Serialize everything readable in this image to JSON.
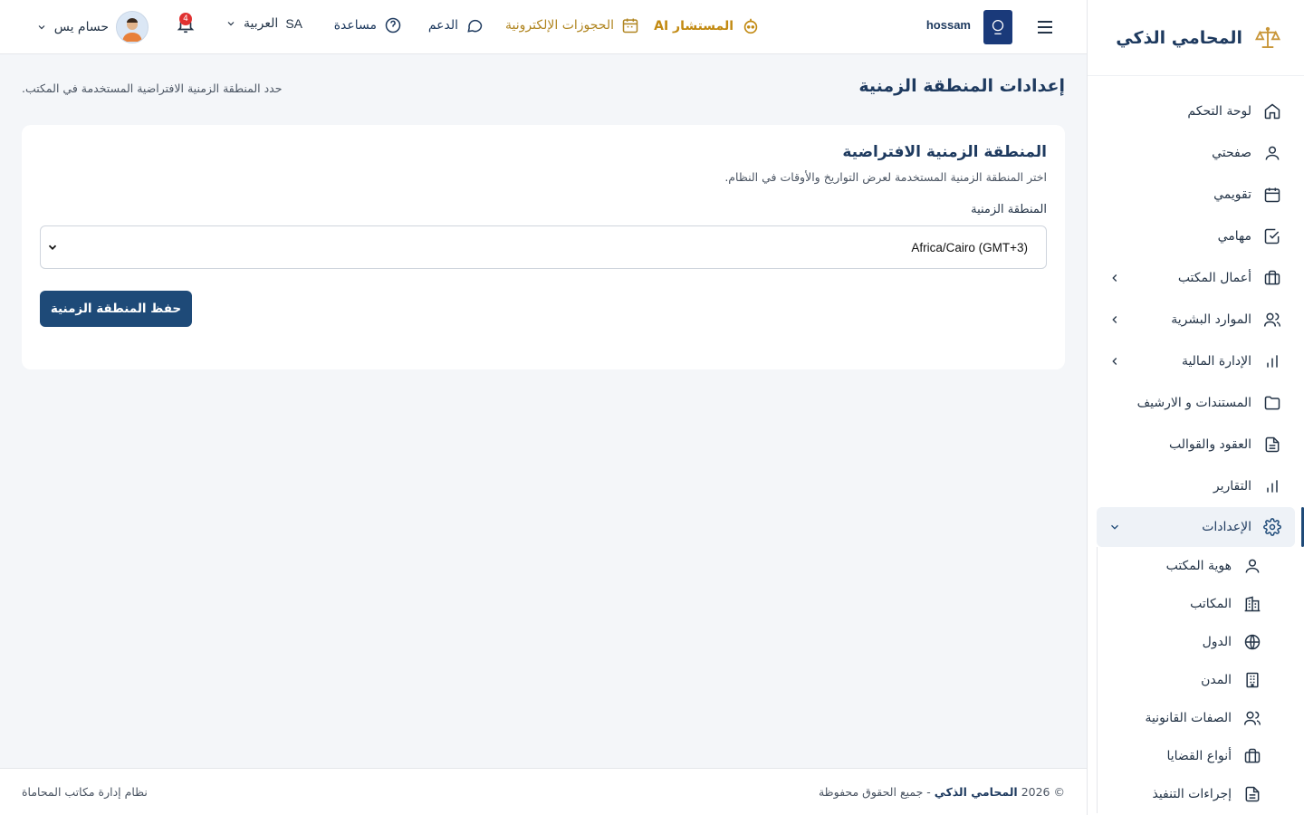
{
  "brand": {
    "name": "المحامي الذكي"
  },
  "sidebar": {
    "items": [
      {
        "label": "لوحة التحكم",
        "icon": "home-icon"
      },
      {
        "label": "صفحتي",
        "icon": "user-icon"
      },
      {
        "label": "تقويمي",
        "icon": "calendar-icon"
      },
      {
        "label": "مهامي",
        "icon": "check-square-icon"
      },
      {
        "label": "أعمال المكتب",
        "icon": "briefcase-icon",
        "expandable": true
      },
      {
        "label": "الموارد البشرية",
        "icon": "users-icon",
        "expandable": true
      },
      {
        "label": "الإدارة المالية",
        "icon": "bar-chart-icon",
        "expandable": true
      },
      {
        "label": "المستندات و الارشيف",
        "icon": "folder-icon"
      },
      {
        "label": "العقود والقوالب",
        "icon": "file-text-icon"
      },
      {
        "label": "التقارير",
        "icon": "bar-chart-icon"
      },
      {
        "label": "الإعدادات",
        "icon": "gear-icon",
        "active": true,
        "expanded": true
      }
    ],
    "settings_sub": [
      {
        "label": "هوية المكتب",
        "icon": "user-icon"
      },
      {
        "label": "المكاتب",
        "icon": "building-icon"
      },
      {
        "label": "الدول",
        "icon": "globe-icon"
      },
      {
        "label": "المدن",
        "icon": "office-icon"
      },
      {
        "label": "الصفات القانونية",
        "icon": "users-icon"
      },
      {
        "label": "أنواع القضايا",
        "icon": "briefcase-icon"
      },
      {
        "label": "إجراءات التنفيذ",
        "icon": "file-text-icon"
      }
    ]
  },
  "topbar": {
    "username": "hossam",
    "ai_label": "المستشار AI",
    "bookings_label": "الحجوزات الإلكترونية",
    "support_label": "الدعم",
    "help_label": "مساعدة",
    "lang_code": "SA",
    "lang_label": "العربية",
    "notifications_count": "4",
    "profile_name": "حسام يس"
  },
  "page": {
    "title": "إعدادات المنطقة الزمنية",
    "subtitle": "حدد المنطقة الزمنية الافتراضية المستخدمة في المكتب."
  },
  "card": {
    "title": "المنطقة الزمنية الافتراضية",
    "description": "اختر المنطقة الزمنية المستخدمة لعرض التواريخ والأوقات في النظام.",
    "field_label": "المنطقة الزمنية",
    "selected_value": "Africa/Cairo (GMT+3)",
    "save_label": "حفظ المنطقة الزمنية"
  },
  "footer": {
    "copyright_prefix": "© 2026",
    "copyright_brand": "المحامي الذكي",
    "copyright_suffix": "- جميع الحقوق محفوظة",
    "system_label": "نظام إدارة مكاتب المحاماة"
  },
  "colors": {
    "primary": "#1e4a78",
    "accent": "#c28a12",
    "badge": "#e03131"
  }
}
